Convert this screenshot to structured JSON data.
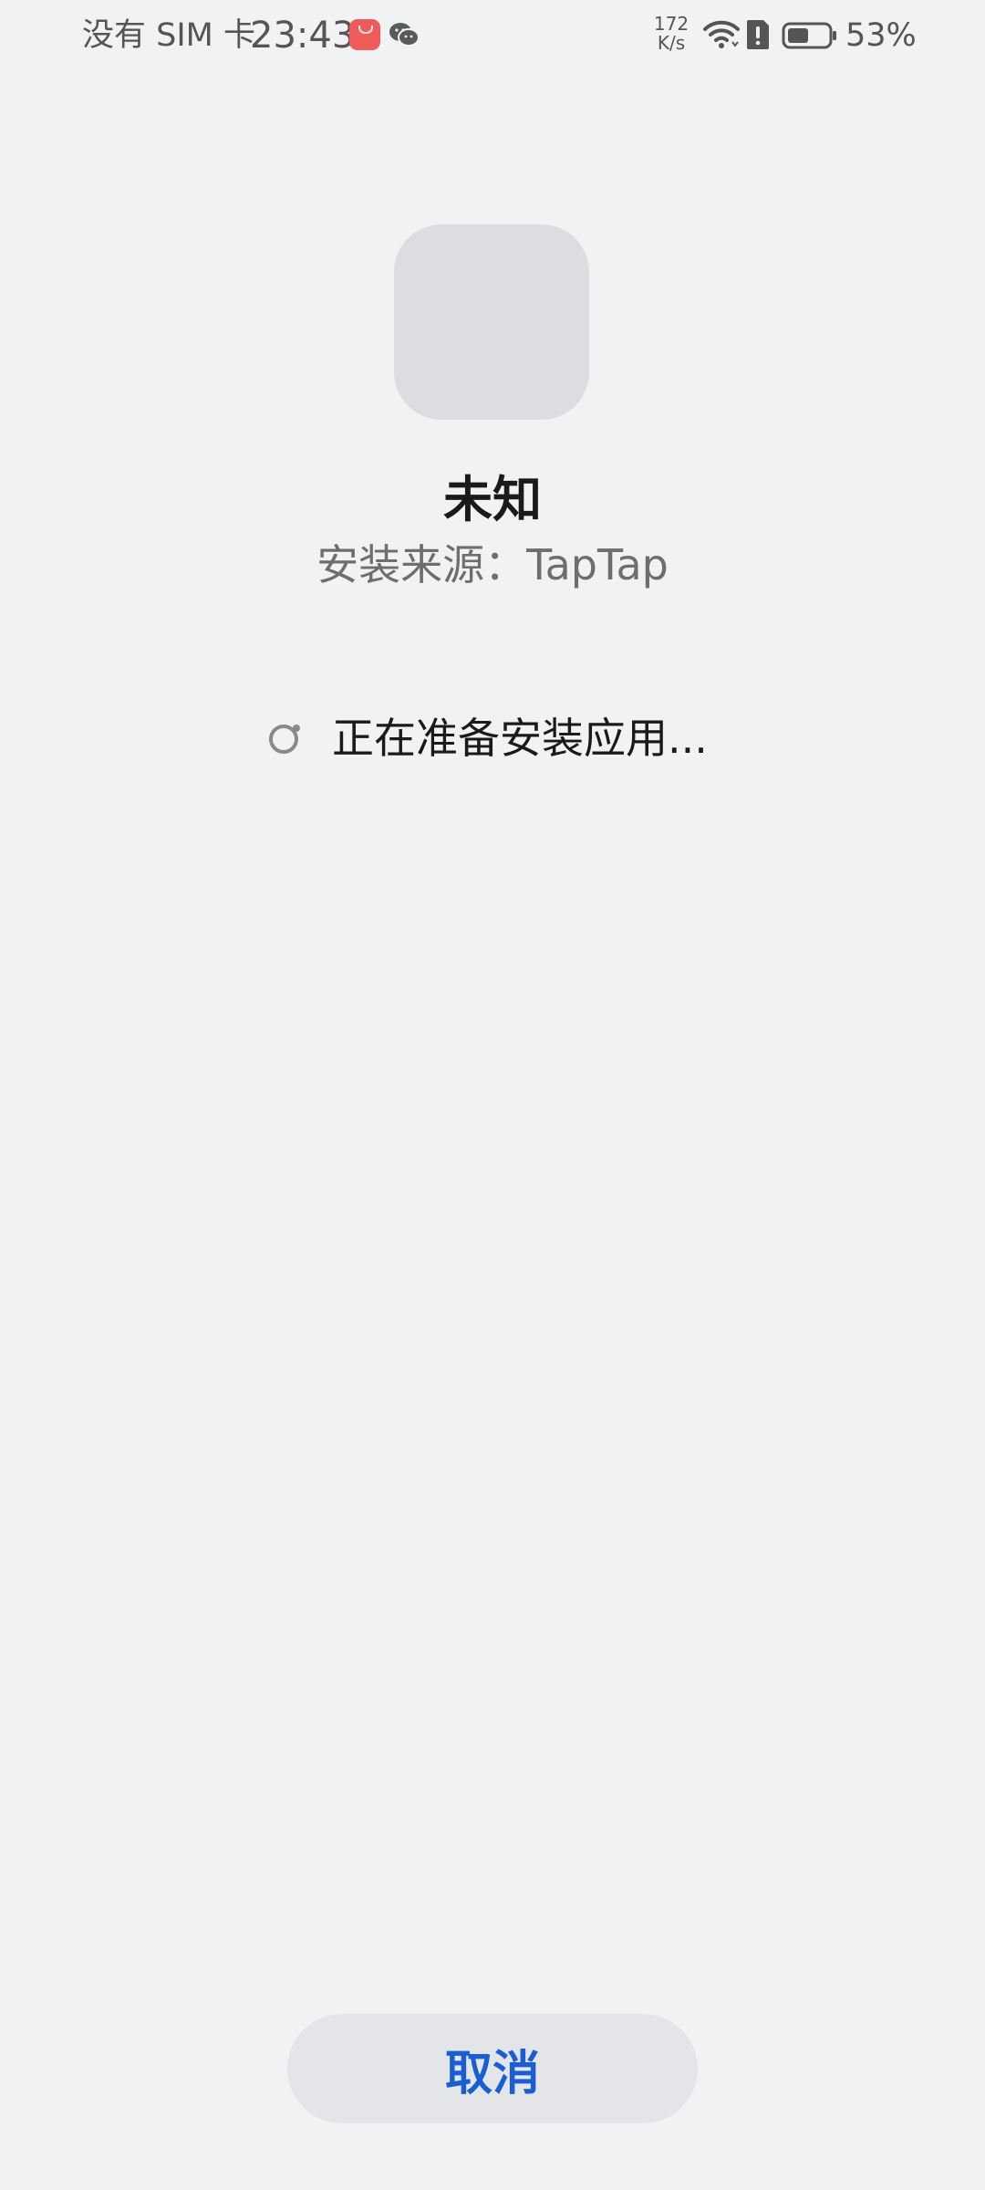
{
  "status_bar": {
    "carrier": "没有 SIM 卡",
    "time": "23:43",
    "net_speed_value": "172",
    "net_speed_unit": "K/s",
    "battery_percent": "53%",
    "battery_level": 0.53,
    "icons": [
      "appgallery-icon",
      "wechat-icon",
      "wifi-icon",
      "alert-icon",
      "battery-icon"
    ]
  },
  "app": {
    "name": "未知",
    "source": "安装来源：TapTap"
  },
  "progress": {
    "text": "正在准备安装应用...",
    "icon": "spinner-icon"
  },
  "actions": {
    "cancel_label": "取消"
  },
  "colors": {
    "background": "#f1f2f4",
    "accent": "#1a5fd1",
    "button_bg": "#e4e5e8",
    "icon_placeholder": "#dcdde0"
  }
}
